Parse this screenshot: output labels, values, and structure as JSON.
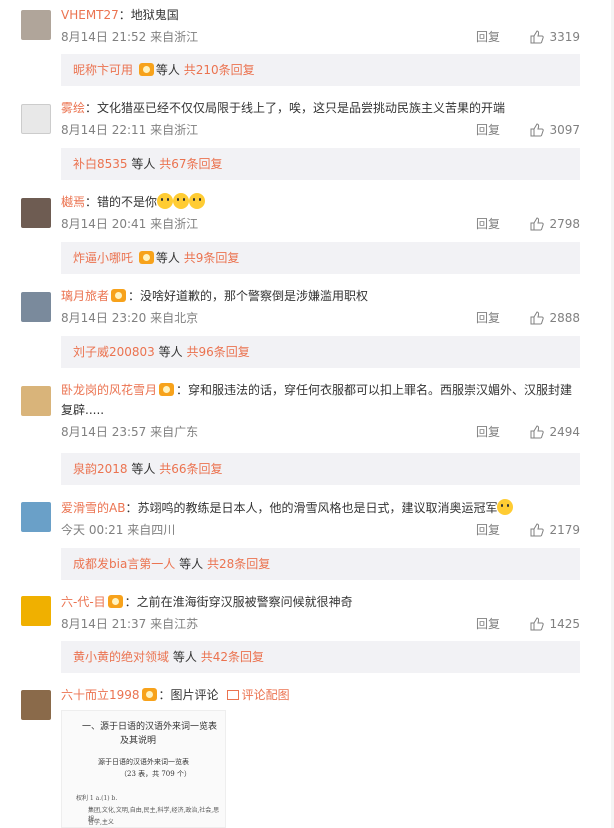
{
  "labels": {
    "reply": "回复",
    "and": "等人",
    "reply_count_suffix": "条回复",
    "total_prefix": "共"
  },
  "comments": [
    {
      "user": "VHEMT27",
      "text": "：地狱鬼国",
      "time": "8月14日 21:52",
      "location": "来自浙江",
      "likes": "3319",
      "sub_user": "昵称卞可用",
      "sub_total": "共210条回复"
    },
    {
      "user": "雾绘",
      "text": "：文化猎巫已经不仅仅局限于线上了，唉，这只是品尝挑动民族主义苦果的开端",
      "time": "8月14日 22:11",
      "location": "来自浙江",
      "likes": "3097",
      "sub_user": "补白8535",
      "sub_total": "共67条回复"
    },
    {
      "user": "樾焉",
      "text": "：错的不是你",
      "time": "8月14日 20:41",
      "location": "来自浙江",
      "likes": "2798",
      "sub_user": "炸逼小哪吒",
      "sub_total": "共9条回复"
    },
    {
      "user": "璃月旅者",
      "text": "：没啥好道歉的，那个警察倒是涉嫌滥用职权",
      "time": "8月14日 23:20",
      "location": "来自北京",
      "likes": "2888",
      "sub_user": "刘子威200803",
      "sub_total": "共96条回复"
    },
    {
      "user": "卧龙岗的风花雪月",
      "text": "：穿和服违法的话，穿任何衣服都可以扣上罪名。西服崇汉媚外、汉服封建",
      "text2": "复辟.....",
      "time": "8月14日 23:57",
      "location": "来自广东",
      "likes": "2494",
      "sub_user": "泉韵2018",
      "sub_total": "共66条回复"
    },
    {
      "user": "爱滑雪的AB",
      "text": "：苏翊鸣的教练是日本人，他的滑雪风格也是日式，建议取消奥运冠军",
      "time": "今天 00:21",
      "location": "来自四川",
      "likes": "2179",
      "sub_user": "成都发bia言第一人",
      "sub_total": "共28条回复"
    },
    {
      "user": "六-代-目",
      "text": "：之前在淮海街穿汉服被警察问候就很神奇",
      "time": "8月14日 21:37",
      "location": "来自江苏",
      "likes": "1425",
      "sub_user": "黄小黄的绝对领域",
      "sub_total": "共42条回复"
    },
    {
      "user": "六十而立1998",
      "text": "：图片评论",
      "link": "评论配图"
    }
  ],
  "thumbnail": {
    "title1": "一、源于日语的汉语外来词一览表",
    "title2": "及其说明",
    "sub1": "源于日语的汉语外来词一览表",
    "sub2": "（23 表，共 709 个）",
    "row1": "权利 1  a.(1) b.",
    "row2": "集团,文化,文明,自由,民主,科学,经济,政治,社会,思想,",
    "row3": "哲学,主义"
  },
  "avatar_colors": [
    "#b0a59a",
    "#dcdcdc",
    "#6e5c52",
    "#7a8a9c",
    "#d9b47a",
    "#6aa0c8",
    "#f0b000",
    "#8a6a4a"
  ]
}
